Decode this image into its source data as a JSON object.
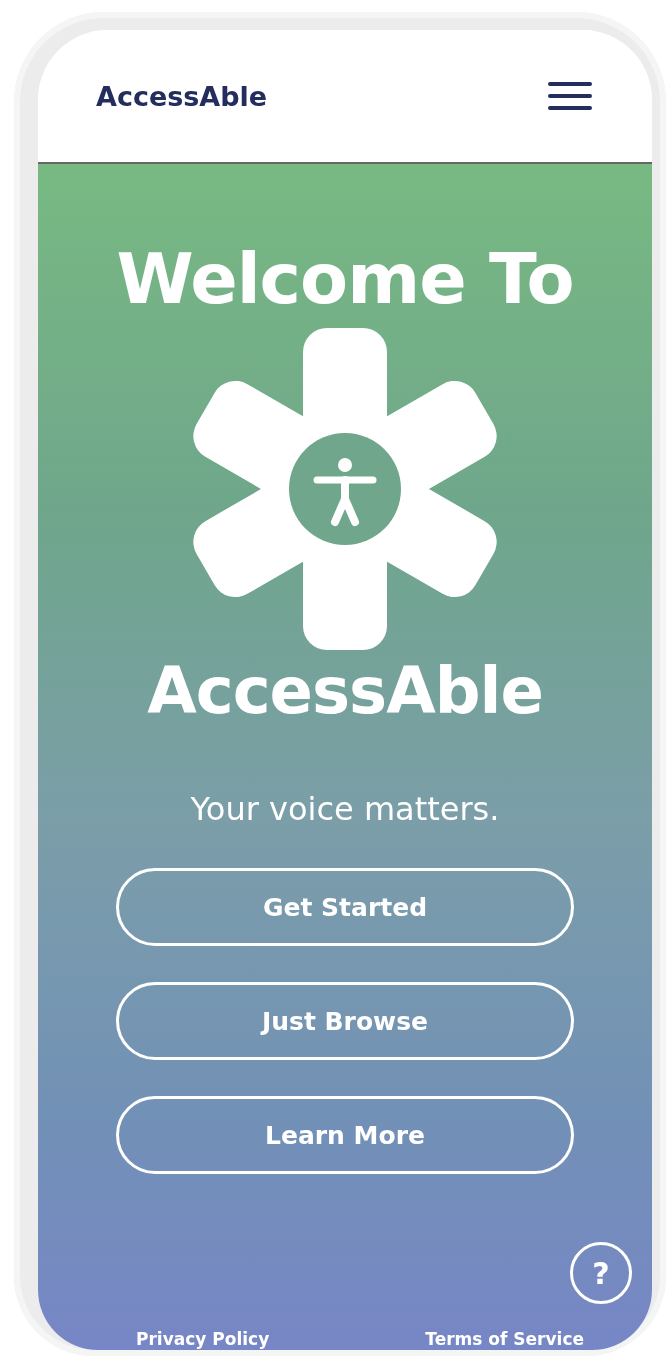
{
  "header": {
    "brand": "AccessAble"
  },
  "hero": {
    "heading": "Welcome To",
    "title": "AccessAble",
    "tagline": "Your voice matters."
  },
  "buttons": [
    {
      "label": "Get Started"
    },
    {
      "label": "Just Browse"
    },
    {
      "label": "Learn More"
    }
  ],
  "help": {
    "label": "?"
  },
  "footer": {
    "links": [
      "Privacy Policy",
      "Terms of Service"
    ]
  }
}
